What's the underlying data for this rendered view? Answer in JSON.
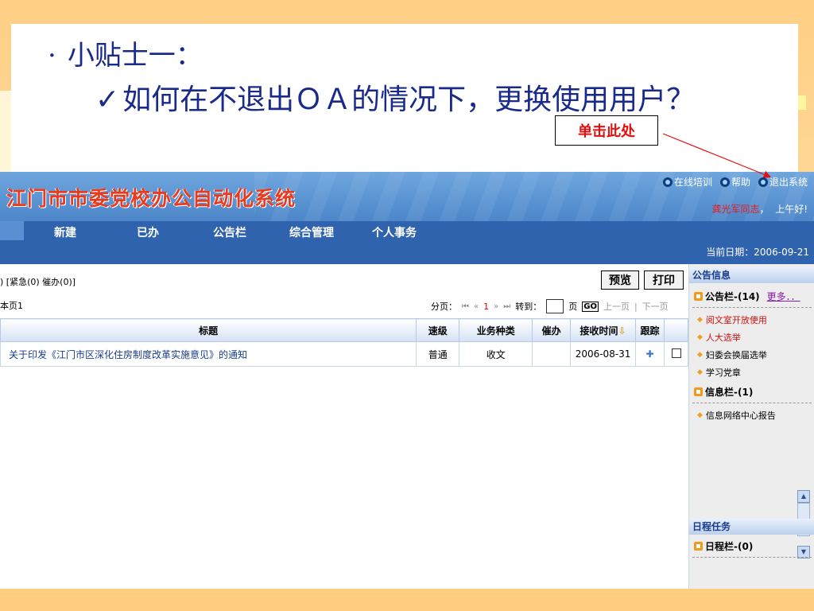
{
  "slide": {
    "bullet_dot": "·",
    "bullet_title": "小贴士一：",
    "check_mark": "✓",
    "tip_text": "如何在不退出ＯＡ的情况下，更换使用用户？",
    "callout_label": "单击此处",
    "callout_color": "#e01010",
    "text_color": "#1a2a8a"
  },
  "oa": {
    "title": "江门市市委党校办公自动化系统",
    "top_links": [
      {
        "label": "在线培训",
        "icon": "globe-icon"
      },
      {
        "label": "帮助",
        "icon": "globe-icon"
      },
      {
        "label": "退出系统",
        "icon": "globe-icon"
      }
    ],
    "greeting_user": "龚光军同志",
    "greeting_sep": "，",
    "greeting_text": "上午好!",
    "nav": [
      "新建",
      "已办",
      "公告栏",
      "综合管理",
      "个人事务"
    ],
    "date_text": "当前日期：2006-09-21",
    "count_line": ") [紧急(0) 催办(0)]",
    "page_line": "本页1",
    "buttons": {
      "preview": "预览",
      "print": "打印"
    },
    "pager": {
      "label": "分页：",
      "first": "⏮",
      "prev": "«",
      "current": "1",
      "next": "»",
      "last": "⏭",
      "goto_label": "转到：",
      "page_unit": "页",
      "go": "GO",
      "prev_page": "上一页",
      "sep": "|",
      "next_page": "下一页"
    },
    "table": {
      "headers": [
        "标题",
        "速级",
        "业务种类",
        "催办",
        "接收时间",
        "跟踪",
        ""
      ],
      "rows": [
        {
          "title": "关于印发《江门市区深化住房制度改革实施意见》的通知",
          "speed": "普通",
          "type": "收文",
          "urge": "",
          "time": "2006-08-31",
          "track": "✚"
        }
      ]
    },
    "side": {
      "notice_head": "公告信息",
      "notice_sub": "公告栏-(14)",
      "more": "更多．．",
      "notice_items": [
        {
          "label": "阅文室开放使用",
          "color": "#d01010"
        },
        {
          "label": "人大选举",
          "color": "#d01010"
        },
        {
          "label": "妇委会换届选举",
          "color": "#000000"
        },
        {
          "label": "学习党章",
          "color": "#000000"
        }
      ],
      "info_sub": "信息栏-(1)",
      "info_items": [
        "信息网络中心报告"
      ],
      "schedule_head": "日程任务",
      "schedule_sub": "日程栏-(0)"
    }
  }
}
